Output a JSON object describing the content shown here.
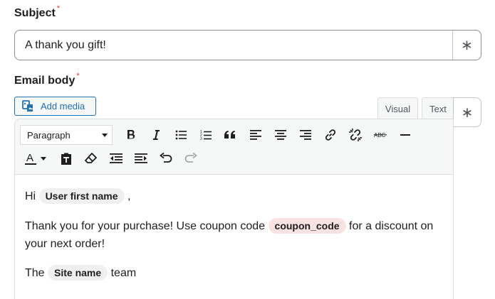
{
  "subject": {
    "label": "Subject",
    "required_mark": "*",
    "value": "A thank you gift!",
    "placeholder_button": "∗"
  },
  "email_body": {
    "label": "Email body",
    "required_mark": "*",
    "add_media_label": "Add media",
    "tabs": {
      "visual": "Visual",
      "text": "Text"
    },
    "placeholder_button": "∗",
    "format_select": "Paragraph",
    "toolbar_row1": [
      "bold-icon",
      "italic-icon",
      "bulleted-list-icon",
      "numbered-list-icon",
      "blockquote-icon",
      "align-left-icon",
      "align-center-icon",
      "align-right-icon",
      "link-icon",
      "unlink-icon",
      "strikethrough-icon",
      "horizontal-line-icon"
    ],
    "toolbar_row2": [
      "text-color-icon",
      "paste-as-text-icon",
      "clear-formatting-icon",
      "outdent-icon",
      "indent-icon",
      "undo-icon",
      "redo-icon"
    ],
    "content": {
      "greeting": {
        "before": "Hi ",
        "tag": "User first name",
        "after": " ,"
      },
      "paragraph2": {
        "before": "Thank you for your purchase! Use coupon code ",
        "tag": "coupon_code",
        "after": " for a discount on your next order!"
      },
      "signoff": {
        "before": "The ",
        "tag": "Site name",
        "after": " team"
      }
    }
  }
}
